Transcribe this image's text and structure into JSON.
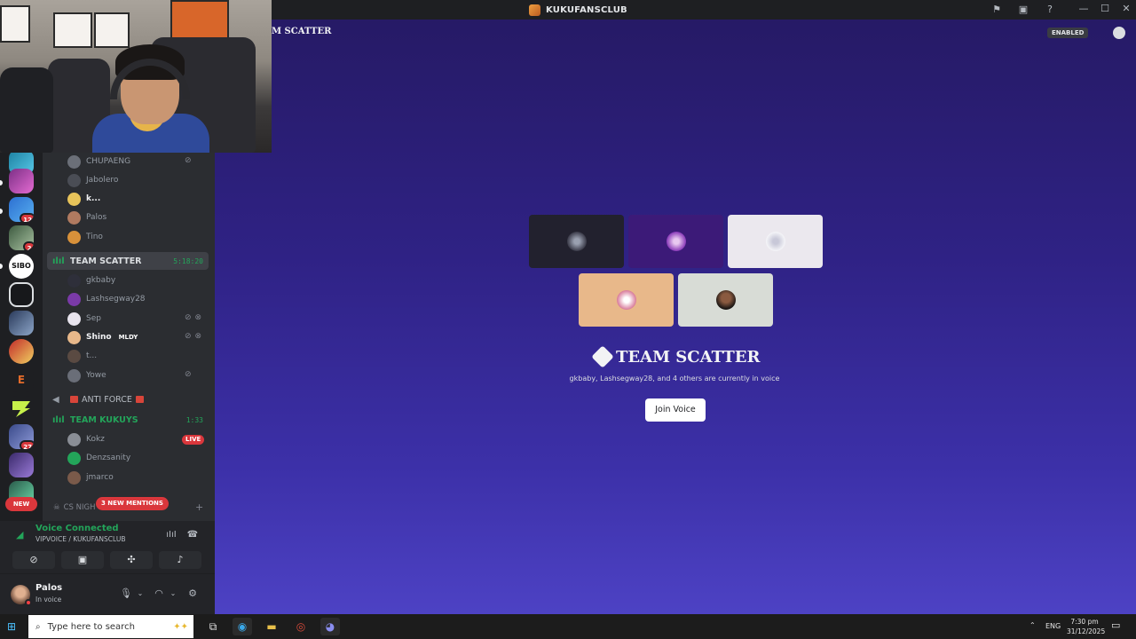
{
  "window": {
    "title": "KUKUFANSCLUB"
  },
  "servers": [
    {
      "name": "server-1",
      "badge": ""
    },
    {
      "name": "server-2",
      "badge": "12"
    },
    {
      "name": "server-3",
      "badge": "2"
    },
    {
      "name": "server-4",
      "label": "SIBO",
      "badge": ""
    },
    {
      "name": "server-5",
      "badge": ""
    },
    {
      "name": "server-6",
      "badge": ""
    },
    {
      "name": "server-7",
      "badge": ""
    },
    {
      "name": "server-8",
      "label": "E",
      "badge": ""
    },
    {
      "name": "server-9",
      "badge": ""
    },
    {
      "name": "server-10",
      "badge": "27"
    },
    {
      "name": "server-11",
      "badge": ""
    },
    {
      "name": "server-12",
      "badge": ""
    }
  ],
  "rail_new_label": "NEW",
  "channel_list": {
    "voice_users_top": [
      "CHUPAENG",
      "Jabolero",
      "k...",
      "Palos",
      "Tino"
    ],
    "team_scatter": {
      "name": "TEAM SCATTER",
      "time": "5:18:20",
      "users": [
        "gkbaby",
        "Lashsegway28",
        "Sep",
        "Shino",
        "t...",
        "Yowe"
      ],
      "shino_tag": "MLDY"
    },
    "anti_force": {
      "name": "ANTI FORCE"
    },
    "team_kukuys": {
      "name": "TEAM KUKUYS",
      "time": "1:33",
      "users": [
        "Kokz",
        "Denzsanity",
        "jmarco"
      ],
      "live_label": "LIVE"
    },
    "mentions_label": "3 NEW MENTIONS",
    "category_label": "CS NIGH"
  },
  "voice_panel": {
    "status": "Voice Connected",
    "channel": "VIPVOICE / KUKUFANSCLUB"
  },
  "user_panel": {
    "name": "Palos",
    "sub": "In voice"
  },
  "main": {
    "header_channel": "M SCATTER",
    "enabled_label": "ENABLED",
    "voice_title": "TEAM SCATTER",
    "voice_subtitle": "gkbaby, Lashsegway28, and 4 others are currently in voice",
    "join_label": "Join Voice"
  },
  "taskbar": {
    "search_placeholder": "Type here to search",
    "language": "ENG",
    "time": "7:30 pm",
    "date": "31/12/2025"
  },
  "colors": {
    "accent_green": "#23a55a",
    "danger_red": "#da373c",
    "main_bg_top": "#261a66",
    "main_bg_bottom": "#4d42c4"
  }
}
